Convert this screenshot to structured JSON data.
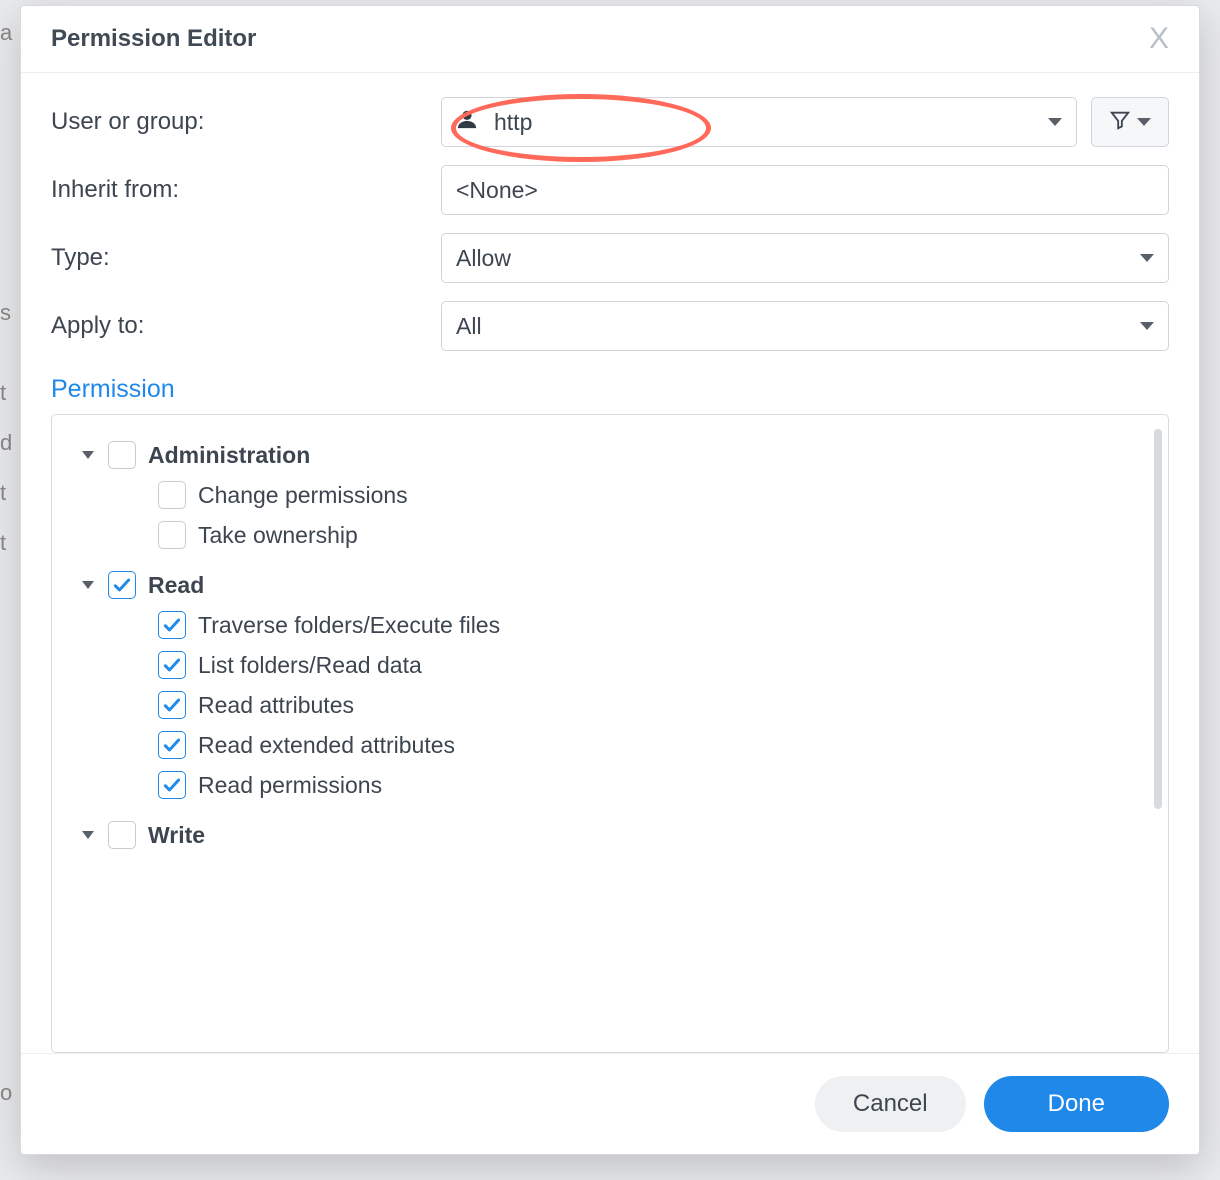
{
  "dialog": {
    "title": "Permission Editor",
    "close_label": "X"
  },
  "form": {
    "user_or_group": {
      "label": "User or group:",
      "value": "http"
    },
    "inherit_from": {
      "label": "Inherit from:",
      "value": "<None>"
    },
    "type": {
      "label": "Type:",
      "value": "Allow"
    },
    "apply_to": {
      "label": "Apply to:",
      "value": "All"
    }
  },
  "section": {
    "heading": "Permission"
  },
  "tree": [
    {
      "label": "Administration",
      "checked": false,
      "expanded": true,
      "children": [
        {
          "label": "Change permissions",
          "checked": false
        },
        {
          "label": "Take ownership",
          "checked": false
        }
      ]
    },
    {
      "label": "Read",
      "checked": true,
      "expanded": true,
      "children": [
        {
          "label": "Traverse folders/Execute files",
          "checked": true
        },
        {
          "label": "List folders/Read data",
          "checked": true
        },
        {
          "label": "Read attributes",
          "checked": true
        },
        {
          "label": "Read extended attributes",
          "checked": true
        },
        {
          "label": "Read permissions",
          "checked": true
        }
      ]
    },
    {
      "label": "Write",
      "checked": false,
      "expanded": true,
      "children": []
    }
  ],
  "footer": {
    "cancel": "Cancel",
    "done": "Done"
  },
  "bg_letters": [
    "a",
    "s",
    "t",
    "d",
    "t",
    "t",
    "o"
  ]
}
